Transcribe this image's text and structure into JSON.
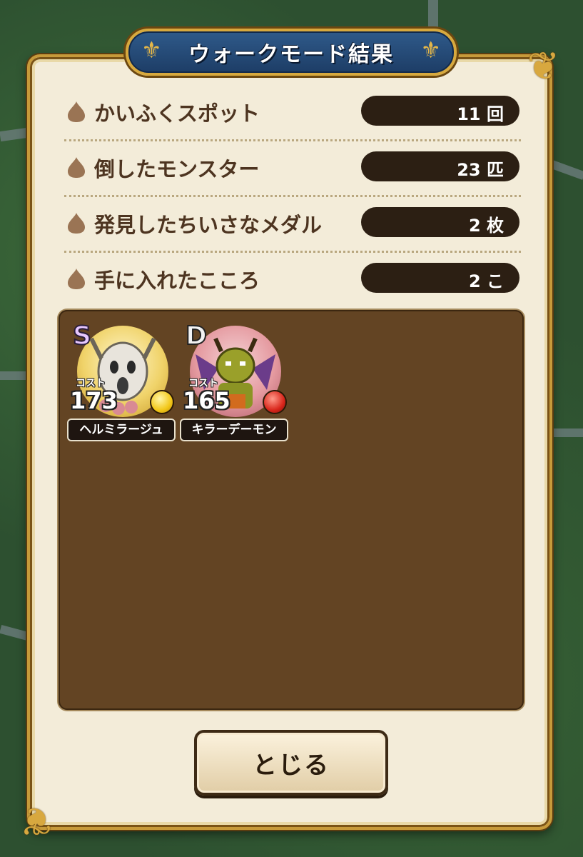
{
  "title": "ウォークモード結果",
  "stats": [
    {
      "label": "かいふくスポット",
      "value": "11 回"
    },
    {
      "label": "倒したモンスター",
      "value": "23 匹"
    },
    {
      "label": "発見したちいさなメダル",
      "value": "2 枚"
    },
    {
      "label": "手に入れたこころ",
      "value": "2 こ"
    }
  ],
  "hearts": [
    {
      "rank": "S",
      "cost_label": "コスト",
      "cost": "173",
      "name": "ヘルミラージュ",
      "gem_color": "#f2c718",
      "orb_color": "#f5e08a"
    },
    {
      "rank": "D",
      "cost_label": "コスト",
      "cost": "165",
      "name": "キラーデーモン",
      "gem_color": "#d9261b",
      "orb_color": "#e59aa0"
    }
  ],
  "close_label": "とじる",
  "colors": {
    "panel": "#f3ecd9",
    "banner": "#1d3d66",
    "gold": "#c79a3a",
    "inventory": "#634423",
    "text": "#4d3420"
  },
  "icons": [
    "chestnut-drop-icon",
    "fleur-de-lis-icon",
    "gold-corner-ornament-icon",
    "rank-s-icon",
    "rank-d-icon",
    "yellow-gem-icon",
    "red-gem-icon"
  ]
}
